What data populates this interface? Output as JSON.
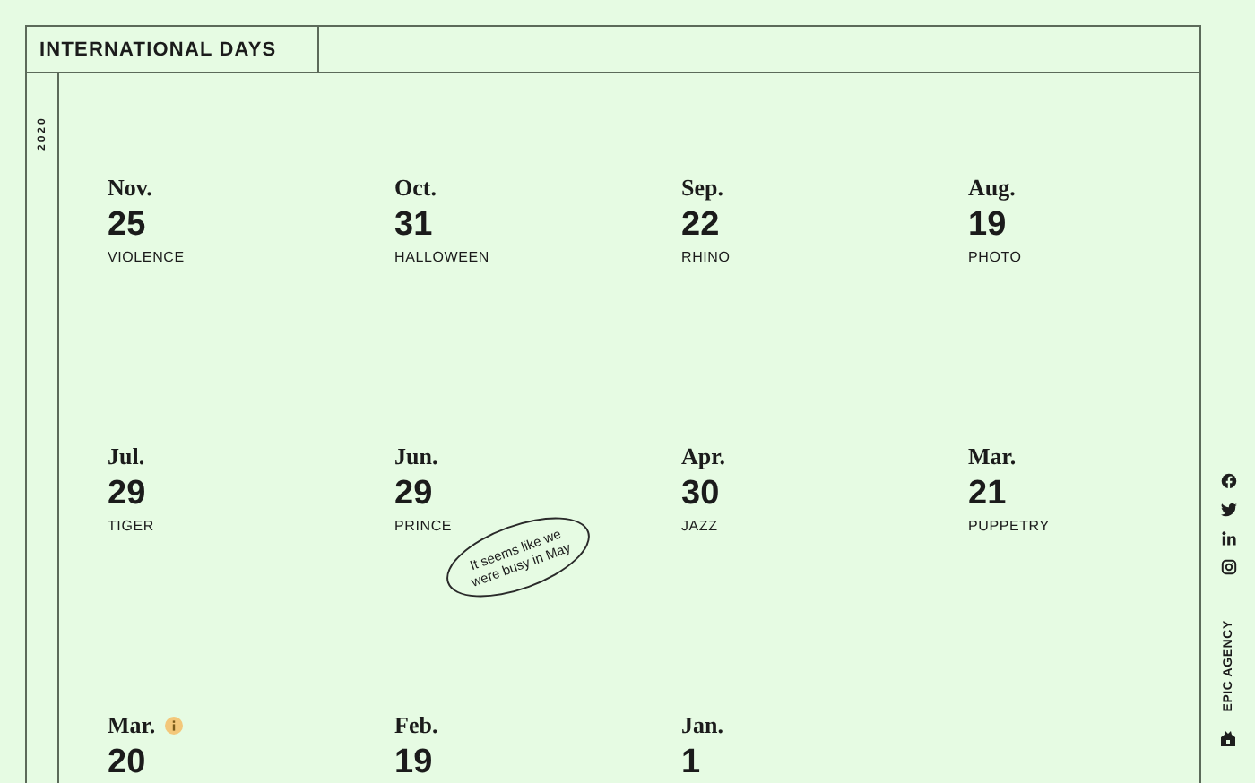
{
  "header": {
    "title": "INTERNATIONAL DAYS",
    "year": "2020"
  },
  "days": [
    {
      "month": "Nov.",
      "day": "25",
      "label": "VIOLENCE",
      "info": false
    },
    {
      "month": "Oct.",
      "day": "31",
      "label": "HALLOWEEN",
      "info": false
    },
    {
      "month": "Sep.",
      "day": "22",
      "label": "RHINO",
      "info": false
    },
    {
      "month": "Aug.",
      "day": "19",
      "label": "PHOTO",
      "info": false
    },
    {
      "month": "Jul.",
      "day": "29",
      "label": "TIGER",
      "info": false
    },
    {
      "month": "Jun.",
      "day": "29",
      "label": "PRINCE",
      "info": false
    },
    {
      "month": "Apr.",
      "day": "30",
      "label": "JAZZ",
      "info": false
    },
    {
      "month": "Mar.",
      "day": "21",
      "label": "PUPPETRY",
      "info": false
    },
    {
      "month": "Mar.",
      "day": "20",
      "info": true
    },
    {
      "month": "Feb.",
      "day": "19",
      "info": false
    },
    {
      "month": "Jan.",
      "day": "1",
      "info": false
    }
  ],
  "sticker": "It seems like we were busy in May",
  "sidebar": {
    "agency": "EPIC AGENCY"
  }
}
